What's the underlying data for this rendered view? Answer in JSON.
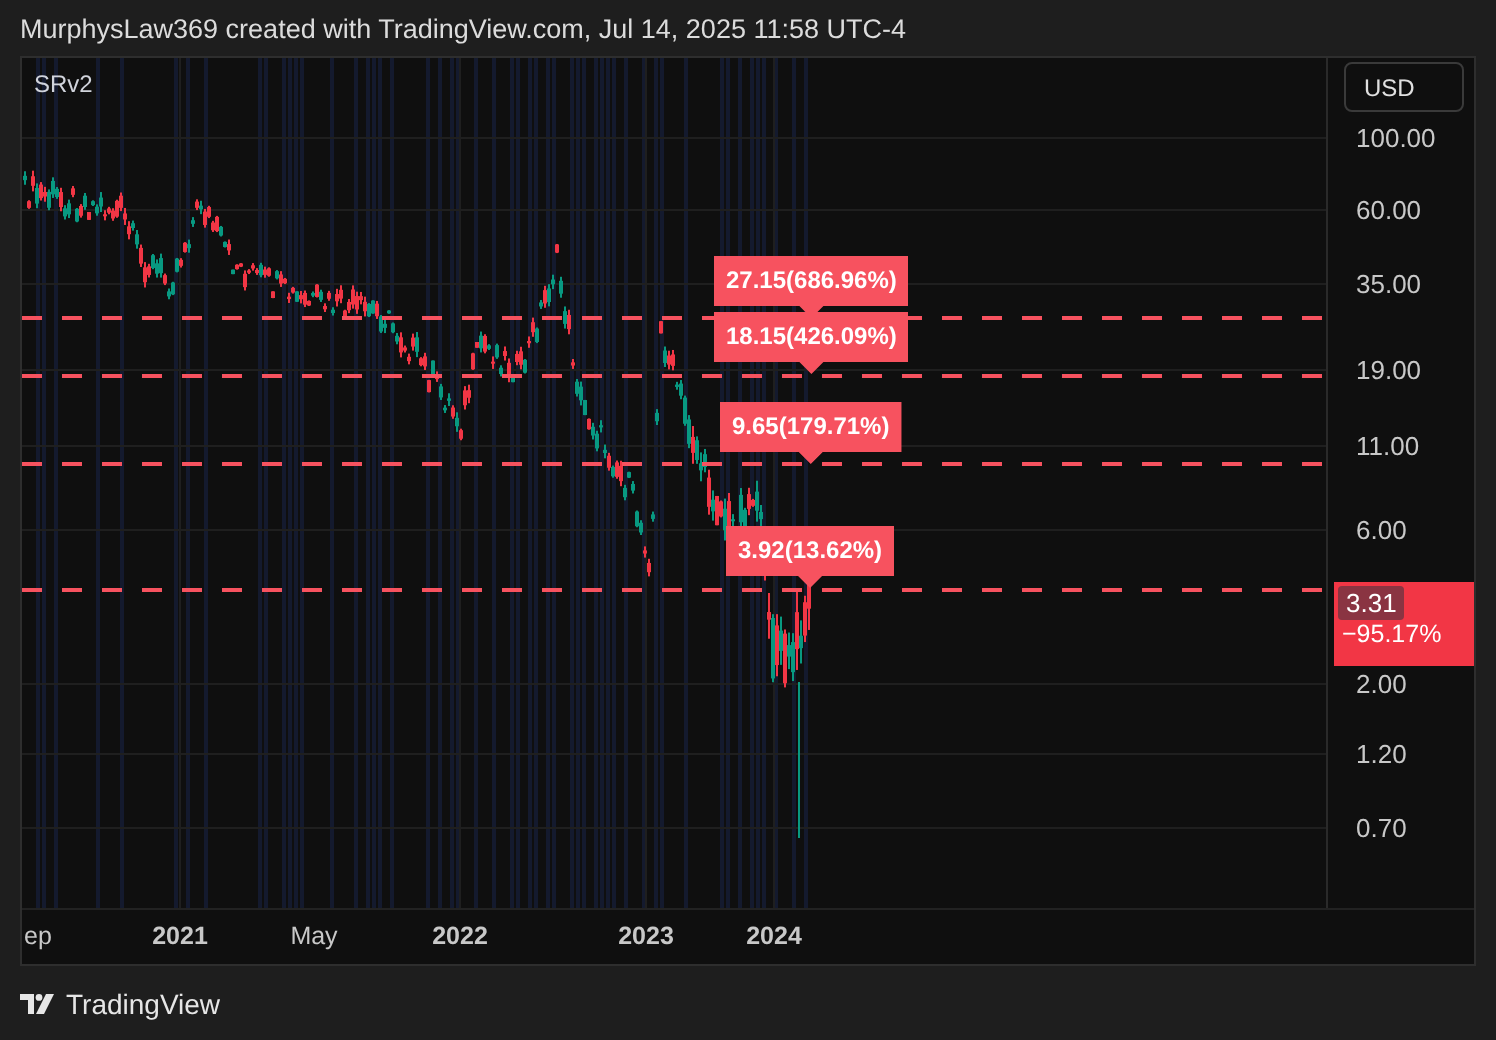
{
  "header": {
    "text": "MurphysLaw369 created with TradingView.com, Jul 14, 2025 11:58 UTC-4"
  },
  "chart": {
    "symbol": "SRv2",
    "currency_button": "USD",
    "price_axis": [
      "100.00",
      "60.00",
      "35.00",
      "19.00",
      "11.00",
      "6.00",
      "2.00",
      "1.20",
      "0.70"
    ],
    "current_price": {
      "price": "3.31",
      "change": "−95.17%"
    },
    "levels": [
      {
        "label": "27.15(686.96%)"
      },
      {
        "label": "18.15(426.09%)"
      },
      {
        "label": "9.65(179.71%)"
      },
      {
        "label": "3.92(13.62%)"
      }
    ],
    "time_axis": [
      {
        "label": "ep",
        "kind": "month"
      },
      {
        "label": "2021",
        "kind": "year"
      },
      {
        "label": "May",
        "kind": "month"
      },
      {
        "label": "2022",
        "kind": "year"
      },
      {
        "label": "2023",
        "kind": "year"
      },
      {
        "label": "2024",
        "kind": "year"
      }
    ]
  },
  "footer": {
    "brand": "TradingView"
  }
}
